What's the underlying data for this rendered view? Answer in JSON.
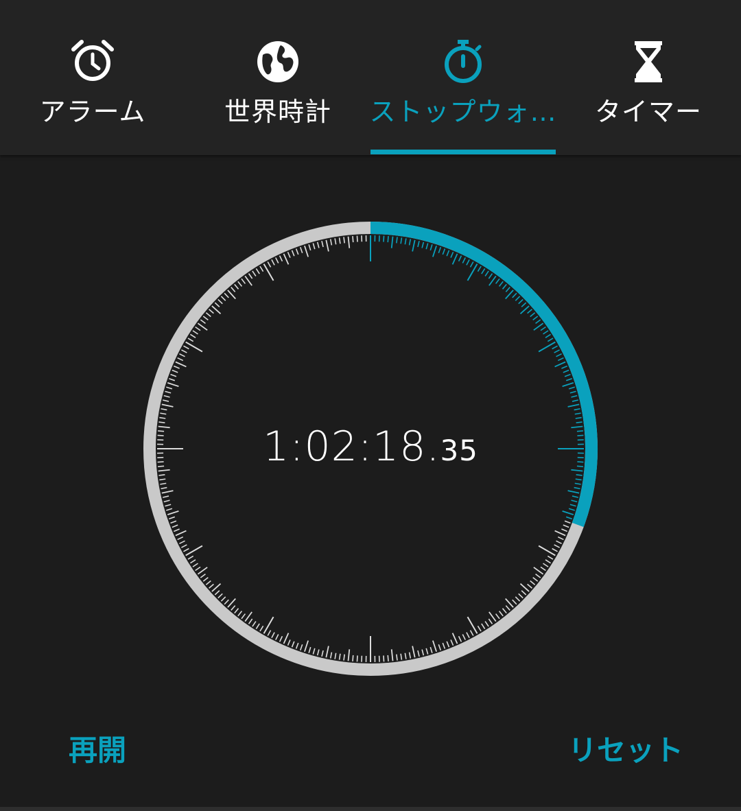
{
  "theme": {
    "accent": "#0aa1bd",
    "ring": "#c9c9c9",
    "tick": "#dcdcdc"
  },
  "tabs": [
    {
      "label": "アラーム",
      "icon": "alarm-clock-icon",
      "active": false
    },
    {
      "label": "世界時計",
      "icon": "globe-icon",
      "active": false
    },
    {
      "label": "ストップウォ…",
      "icon": "stopwatch-icon",
      "active": true
    },
    {
      "label": "タイマー",
      "icon": "hourglass-icon",
      "active": false
    }
  ],
  "stopwatch": {
    "time_main": "1:02:18.",
    "time_fraction": "35",
    "progress_fraction": 0.306
  },
  "actions": {
    "left_label": "再開",
    "right_label": "リセット"
  }
}
